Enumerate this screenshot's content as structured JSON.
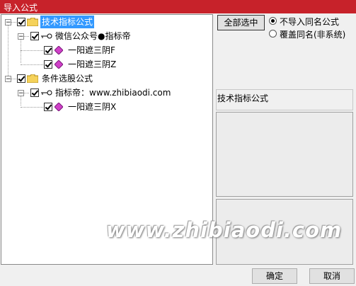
{
  "window": {
    "title": "导入公式"
  },
  "tree": {
    "root1": {
      "label": "技术指标公式"
    },
    "author1": {
      "label": "微信公众号●指标帝"
    },
    "f1": {
      "label": "一阳遮三阴F"
    },
    "f2": {
      "label": "一阳遮三阴Z"
    },
    "root2": {
      "label": "条件选股公式"
    },
    "author2": {
      "label": "指标帝：www.zhibiaodi.com"
    },
    "f3": {
      "label": "一阳遮三阴X"
    }
  },
  "options": {
    "select_all": "全部选中",
    "radio1": "不导入同名公式",
    "radio2": "覆盖同名(非系统)",
    "selected": "不导入同名公式"
  },
  "info": {
    "category": "技术指标公式"
  },
  "watermark": "www.zhibiaodi.com",
  "buttons": {
    "ok": "确定",
    "cancel": "取消"
  }
}
